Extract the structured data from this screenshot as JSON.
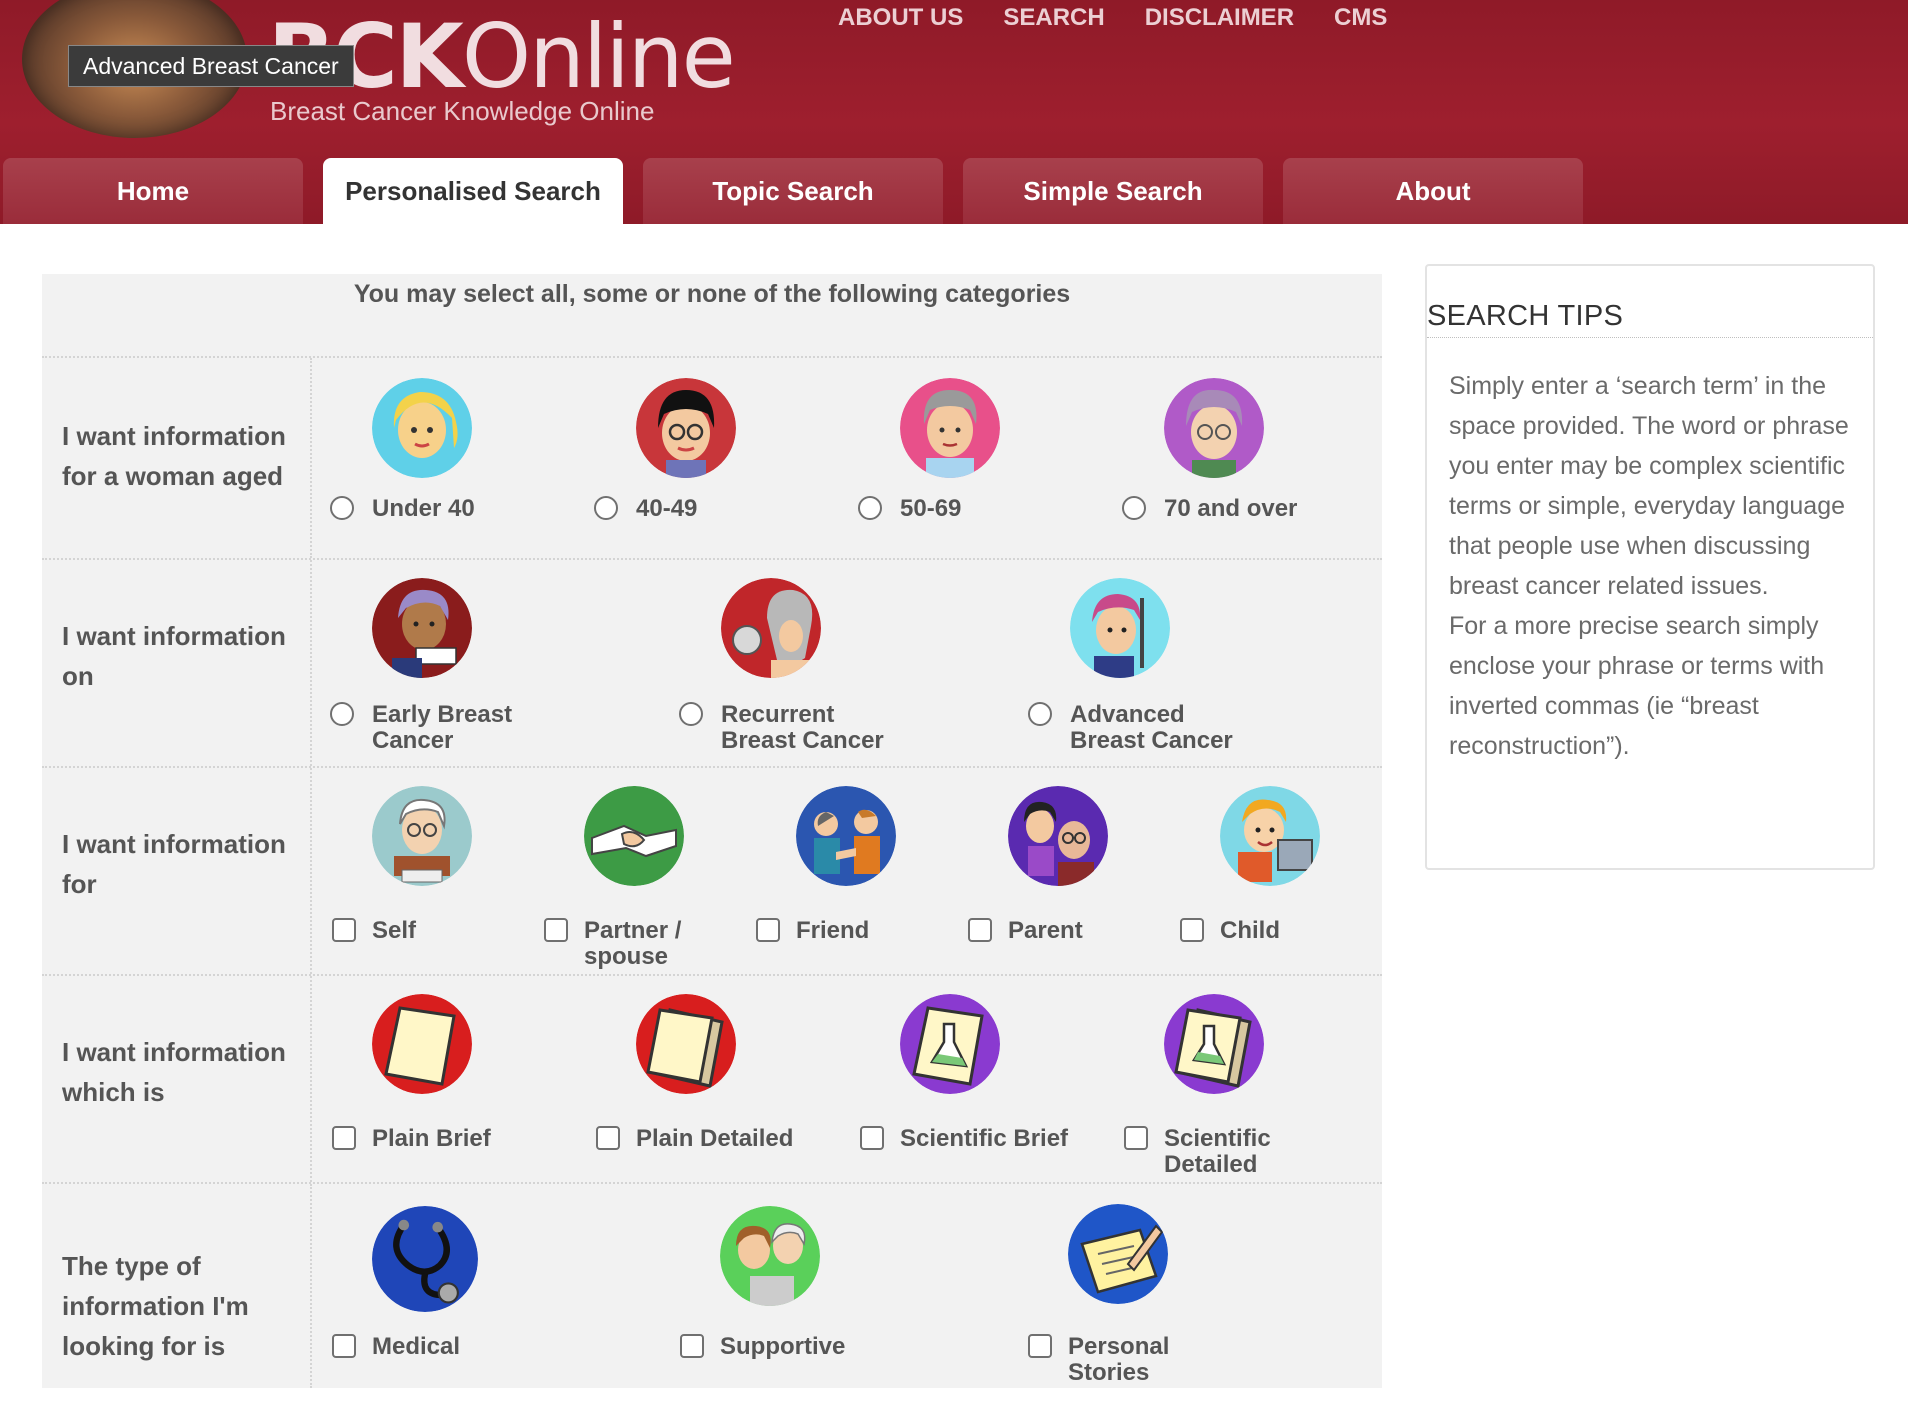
{
  "header": {
    "logo_tooltip": "Advanced Breast Cancer",
    "logo_title_bold": "BCK",
    "logo_title_rest": "Online",
    "logo_subtitle": "Breast Cancer Knowledge Online",
    "brand_color": "#9b1e2d"
  },
  "top_nav": [
    "ABOUT US",
    "SEARCH",
    "DISCLAIMER",
    "CMS"
  ],
  "tabs": [
    {
      "label": "Home",
      "active": false
    },
    {
      "label": "Personalised Search",
      "active": true
    },
    {
      "label": "Topic Search",
      "active": false
    },
    {
      "label": "Simple Search",
      "active": false
    },
    {
      "label": "About",
      "active": false
    }
  ],
  "form": {
    "intro": "You may select all, some or none of the following categories",
    "rows": [
      {
        "label": "I want information for a woman aged",
        "input_type": "radio",
        "options": [
          {
            "label": "Under 40",
            "icon": "young-woman-icon"
          },
          {
            "label": "40-49",
            "icon": "woman-glasses-icon"
          },
          {
            "label": "50-69",
            "icon": "grey-hair-woman-icon"
          },
          {
            "label": "70 and over",
            "icon": "elderly-woman-icon"
          }
        ]
      },
      {
        "label": "I want information on",
        "input_type": "radio",
        "options": [
          {
            "label": "Early Breast Cancer",
            "icon": "woman-reading-icon"
          },
          {
            "label": "Recurrent Breast Cancer",
            "icon": "woman-mirror-icon"
          },
          {
            "label": "Advanced Breast Cancer",
            "icon": "woman-headscarf-icon"
          }
        ]
      },
      {
        "label": "I want information for",
        "input_type": "checkbox",
        "options": [
          {
            "label": "Self",
            "icon": "woman-typing-icon"
          },
          {
            "label": "Partner / spouse",
            "icon": "handshake-icon"
          },
          {
            "label": "Friend",
            "icon": "friends-icon"
          },
          {
            "label": "Parent",
            "icon": "parents-icon"
          },
          {
            "label": "Child",
            "icon": "child-computer-icon"
          }
        ]
      },
      {
        "label": "I want information which is",
        "input_type": "checkbox",
        "options": [
          {
            "label": "Plain Brief",
            "icon": "paper-sheet-icon"
          },
          {
            "label": "Plain Detailed",
            "icon": "paper-stack-icon"
          },
          {
            "label": "Scientific Brief",
            "icon": "flask-sheet-icon"
          },
          {
            "label": "Scientific Detailed",
            "icon": "flask-stack-icon"
          }
        ]
      },
      {
        "label": "The type of information I'm looking for is",
        "input_type": "checkbox",
        "options": [
          {
            "label": "Medical",
            "icon": "stethoscope-icon"
          },
          {
            "label": "Supportive",
            "icon": "support-people-icon"
          },
          {
            "label": "Personal Stories",
            "icon": "writing-hand-icon"
          }
        ]
      }
    ]
  },
  "search_tips": {
    "title": "SEARCH TIPS",
    "paragraph_1": "Simply enter a ‘search term’ in the space provided. The word or phrase you enter may be complex scientific terms or simple, everyday language that people use when discussing breast cancer related issues.",
    "paragraph_2": "For a more precise search simply enclose your phrase or terms with inverted commas (ie “breast reconstruction”)."
  }
}
